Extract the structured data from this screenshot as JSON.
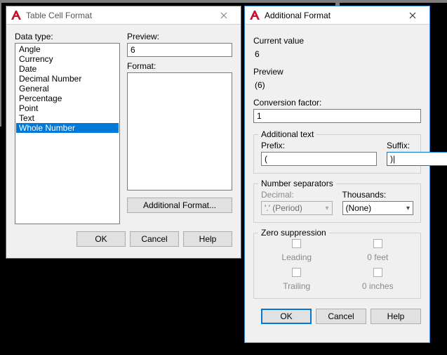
{
  "dialog1": {
    "title": "Table Cell Format",
    "dataTypeLabel": "Data type:",
    "items": [
      "Angle",
      "Currency",
      "Date",
      "Decimal Number",
      "General",
      "Percentage",
      "Point",
      "Text",
      "Whole Number"
    ],
    "selectedIndex": 8,
    "previewLabel": "Preview:",
    "previewValue": "6",
    "formatLabel": "Format:",
    "additionalBtn": "Additional Format...",
    "ok": "OK",
    "cancel": "Cancel",
    "help": "Help"
  },
  "dialog2": {
    "title": "Additional Format",
    "currentValueLabel": "Current value",
    "currentValue": "6",
    "previewLabel": "Preview",
    "previewValue": "(6)",
    "conversionLabel": "Conversion factor:",
    "conversionValue": "1",
    "additionalTextTitle": "Additional text",
    "prefixLabel": "Prefix:",
    "prefixValue": "(",
    "suffixLabel": "Suffix:",
    "suffixValue": ")|",
    "numSepTitle": "Number separators",
    "decimalLabel": "Decimal:",
    "decimalValue": "'.' (Period)",
    "thousandsLabel": "Thousands:",
    "thousandsValue": "(None)",
    "zeroTitle": "Zero suppression",
    "leading": "Leading",
    "trailing": "Trailing",
    "feet": "0 feet",
    "inches": "0 inches",
    "ok": "OK",
    "cancel": "Cancel",
    "help": "Help"
  }
}
